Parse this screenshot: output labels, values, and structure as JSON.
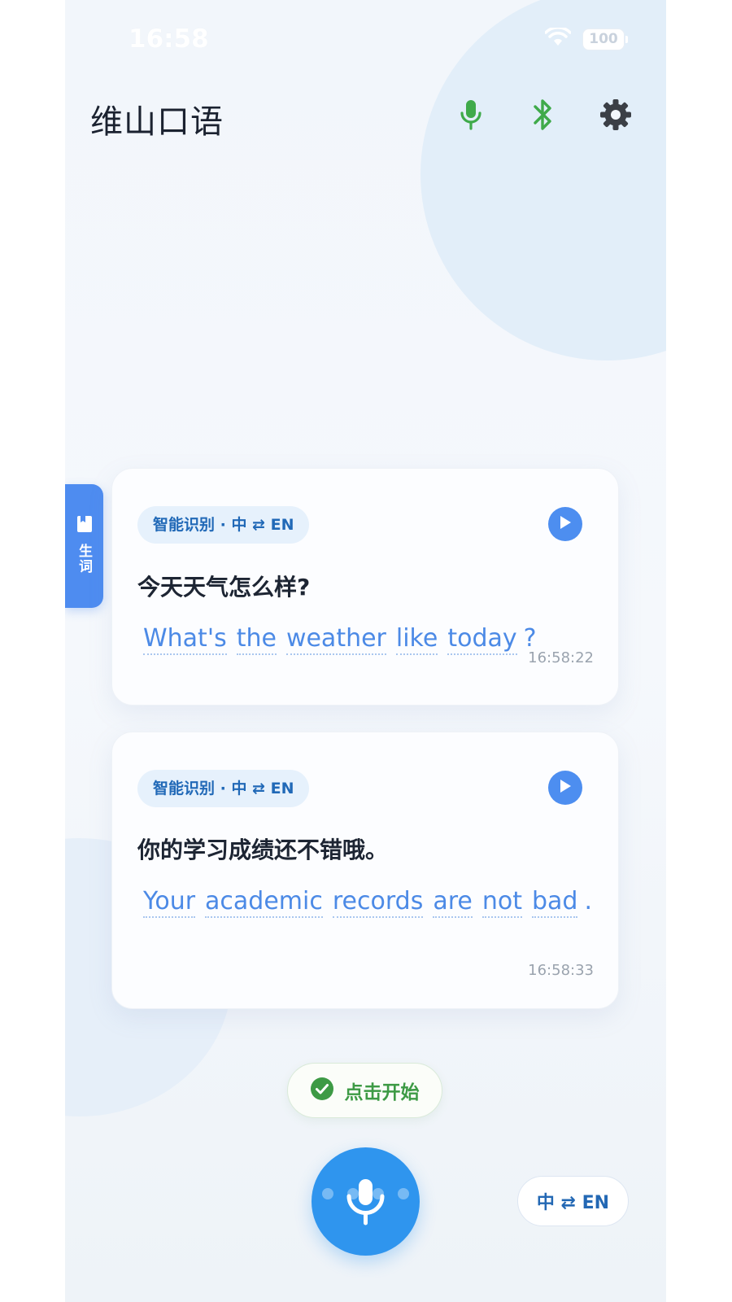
{
  "status_bar": {
    "time": "16:58",
    "battery": "100"
  },
  "header": {
    "title": "维山口语",
    "icons": [
      "microphone-icon",
      "bluetooth-icon",
      "settings-gear-icon"
    ]
  },
  "side_tab": {
    "label": "生词",
    "icon": "book-icon"
  },
  "cards": [
    {
      "mode": "智能识别 · 中 ⇄ EN",
      "source": "今天天气怎么样?",
      "translation_words": [
        "What's",
        "the",
        "weather",
        "like",
        "today"
      ],
      "translation_end": "?",
      "time": "16:58:22"
    },
    {
      "mode": "智能识别 · 中 ⇄ EN",
      "source": "你的学习成绩还不错哦。",
      "translation_words": [
        "Your",
        "academic",
        "records",
        "are",
        "not",
        "bad"
      ],
      "translation_end": ".",
      "time": "16:58:33"
    }
  ],
  "start_button": {
    "label": "点击开始"
  },
  "language_toggle": {
    "label": "中 ⇄ EN"
  },
  "colors": {
    "accent_blue": "#4e8cf0",
    "mic_blue": "#2f95ee",
    "green": "#3d9a45",
    "text_dark": "#1d2533"
  }
}
